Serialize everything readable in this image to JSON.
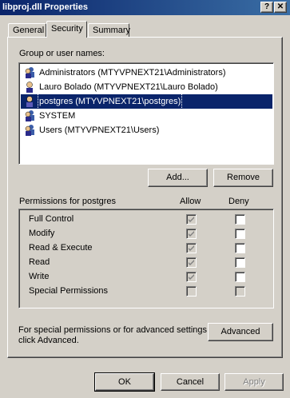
{
  "window": {
    "title": "libproj.dll Properties",
    "help_label": "?",
    "close_label": "✕"
  },
  "tabs": [
    {
      "label": "General",
      "active": false
    },
    {
      "label": "Security",
      "active": true
    },
    {
      "label": "Summary",
      "active": false
    }
  ],
  "users": {
    "label": "Group or user names:",
    "items": [
      {
        "name": "Administrators (MTYVPNEXT21\\Administrators)",
        "selected": false
      },
      {
        "name": "Lauro Bolado (MTYVPNEXT21\\Lauro Bolado)",
        "selected": false
      },
      {
        "name": "postgres (MTYVPNEXT21\\postgres)",
        "selected": true
      },
      {
        "name": "SYSTEM",
        "selected": false
      },
      {
        "name": "Users (MTYVPNEXT21\\Users)",
        "selected": false
      }
    ],
    "add_label": "Add...",
    "remove_label": "Remove"
  },
  "permissions": {
    "label": "Permissions for postgres",
    "allow_header": "Allow",
    "deny_header": "Deny",
    "rows": [
      {
        "name": "Full Control",
        "allow": true,
        "allow_disabled": true,
        "deny": false,
        "deny_disabled": false
      },
      {
        "name": "Modify",
        "allow": true,
        "allow_disabled": true,
        "deny": false,
        "deny_disabled": false
      },
      {
        "name": "Read & Execute",
        "allow": true,
        "allow_disabled": true,
        "deny": false,
        "deny_disabled": false
      },
      {
        "name": "Read",
        "allow": true,
        "allow_disabled": true,
        "deny": false,
        "deny_disabled": false
      },
      {
        "name": "Write",
        "allow": true,
        "allow_disabled": true,
        "deny": false,
        "deny_disabled": false
      },
      {
        "name": "Special Permissions",
        "allow": false,
        "allow_disabled": true,
        "deny": false,
        "deny_disabled": true
      }
    ]
  },
  "advanced": {
    "text_line1": "For special permissions or for advanced settings,",
    "text_line2": "click Advanced.",
    "button_label": "Advanced"
  },
  "footer": {
    "ok_label": "OK",
    "cancel_label": "Cancel",
    "apply_label": "Apply"
  },
  "colors": {
    "titlebar": "#0a246a",
    "selection": "#0a246a",
    "face": "#d4d0c8"
  }
}
